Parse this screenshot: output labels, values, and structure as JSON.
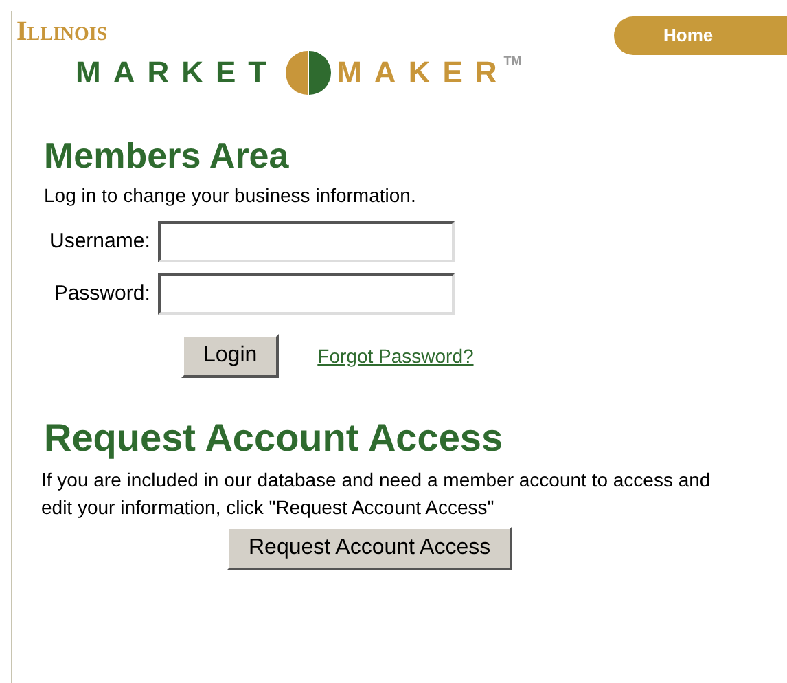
{
  "logo": {
    "state": "Illinois",
    "word_1": "MARKET",
    "word_2": "MAKER",
    "mark": "TM"
  },
  "nav": [
    {
      "label": "Home"
    }
  ],
  "members": {
    "title": "Members Area",
    "intro": "Log in to change your business information.",
    "fields": [
      {
        "label": "Username:"
      },
      {
        "label": "Password:"
      }
    ],
    "login_button": "Login",
    "forgot_link": "Forgot Password?"
  },
  "request": {
    "title": "Request Account Access",
    "text": "If you are included in our database and need a member account to access and edit your information, click \"Request Account Access\"",
    "button": "Request Account Access"
  }
}
